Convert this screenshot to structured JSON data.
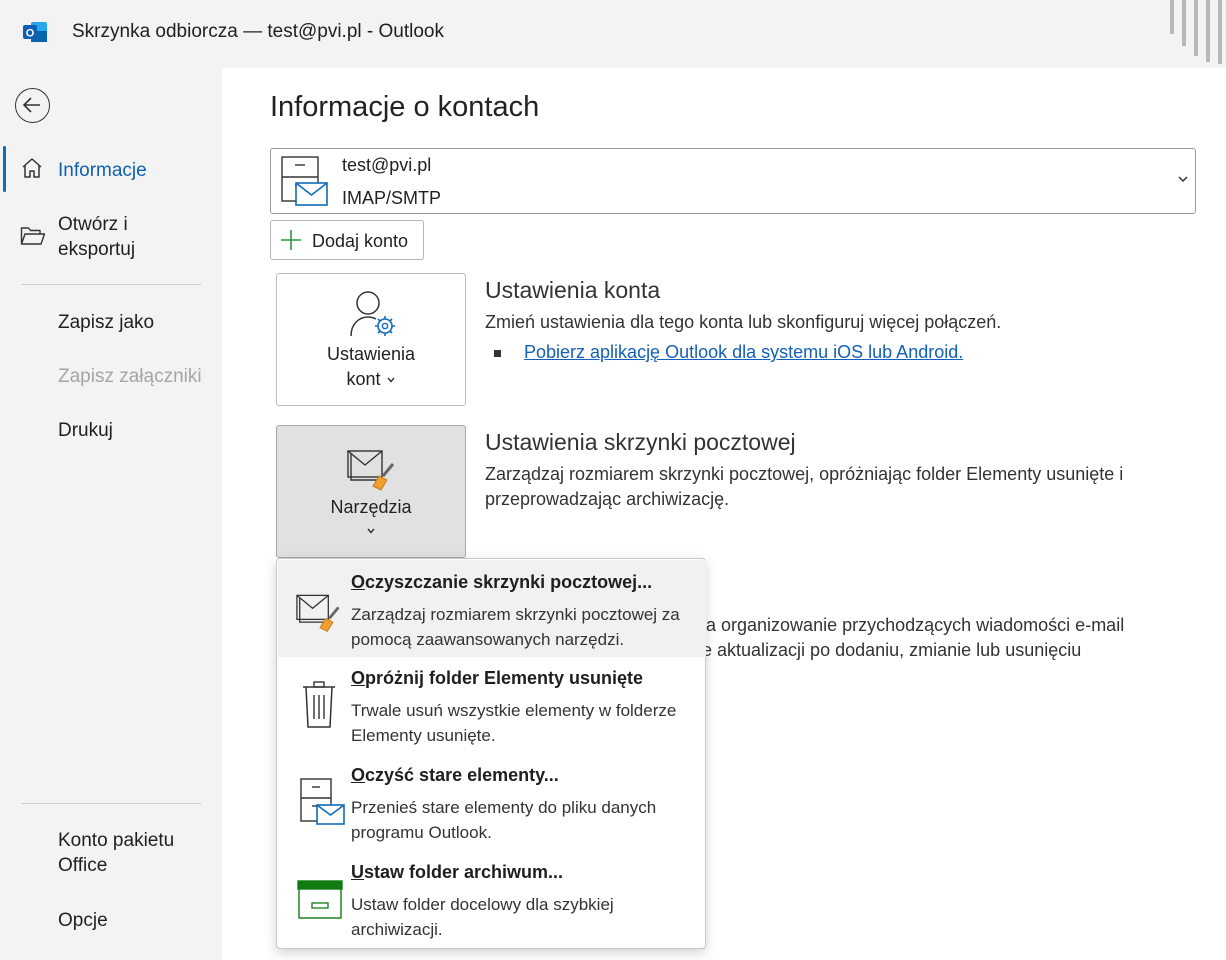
{
  "window": {
    "title": "Skrzynka odbiorcza — test@pvi.pl  -  Outlook"
  },
  "sidebar": {
    "items": [
      {
        "label": "Informacje"
      },
      {
        "label": "Otwórz i eksportuj"
      },
      {
        "label": "Zapisz jako"
      },
      {
        "label": "Zapisz załączniki"
      },
      {
        "label": "Drukuj"
      },
      {
        "label": "Konto pakietu Office"
      },
      {
        "label": "Opcje"
      }
    ]
  },
  "main": {
    "title": "Informacje o kontach",
    "account": {
      "email": "test@pvi.pl",
      "type": "IMAP/SMTP"
    },
    "add_account_label": "Dodaj konto",
    "account_settings": {
      "button_line1": "Ustawienia",
      "button_line2": "kont",
      "title": "Ustawienia konta",
      "description": "Zmień ustawienia dla tego konta lub skonfiguruj więcej połączeń.",
      "link": "Pobierz aplikację Outlook dla systemu iOS lub Android."
    },
    "mailbox_settings": {
      "button_label": "Narzędzia",
      "title": "Ustawienia skrzynki pocztowej",
      "description": "Zarządzaj rozmiarem skrzynki pocztowej, opróżniając folder Elementy usunięte i przeprowadzając archiwizację."
    },
    "rules_partial": {
      "line1": "ia organizowanie przychodzących wiadomości e-mail",
      "line2": "e aktualizacji po dodaniu, zmianie lub usunięciu"
    }
  },
  "tools_menu": {
    "items": [
      {
        "title_u": "O",
        "title_rest": "czyszczanie skrzynki pocztowej...",
        "desc": "Zarządzaj rozmiarem skrzynki pocztowej za pomocą zaawansowanych narzędzi."
      },
      {
        "title_u": "O",
        "title_rest": "próżnij folder Elementy usunięte",
        "desc": "Trwale usuń wszystkie elementy w folderze Elementy usunięte."
      },
      {
        "title_u": "O",
        "title_rest": "czyść stare elementy...",
        "desc": "Przenieś stare elementy do pliku danych programu Outlook."
      },
      {
        "title_u": "U",
        "title_rest": "staw folder archiwum...",
        "desc": "Ustaw folder docelowy dla szybkiej archiwizacji."
      }
    ]
  },
  "colors": {
    "accent": "#0f6cbd",
    "link": "#1360b8",
    "sidebar_bg": "#f3f3f3",
    "archive_green": "#107c10"
  }
}
